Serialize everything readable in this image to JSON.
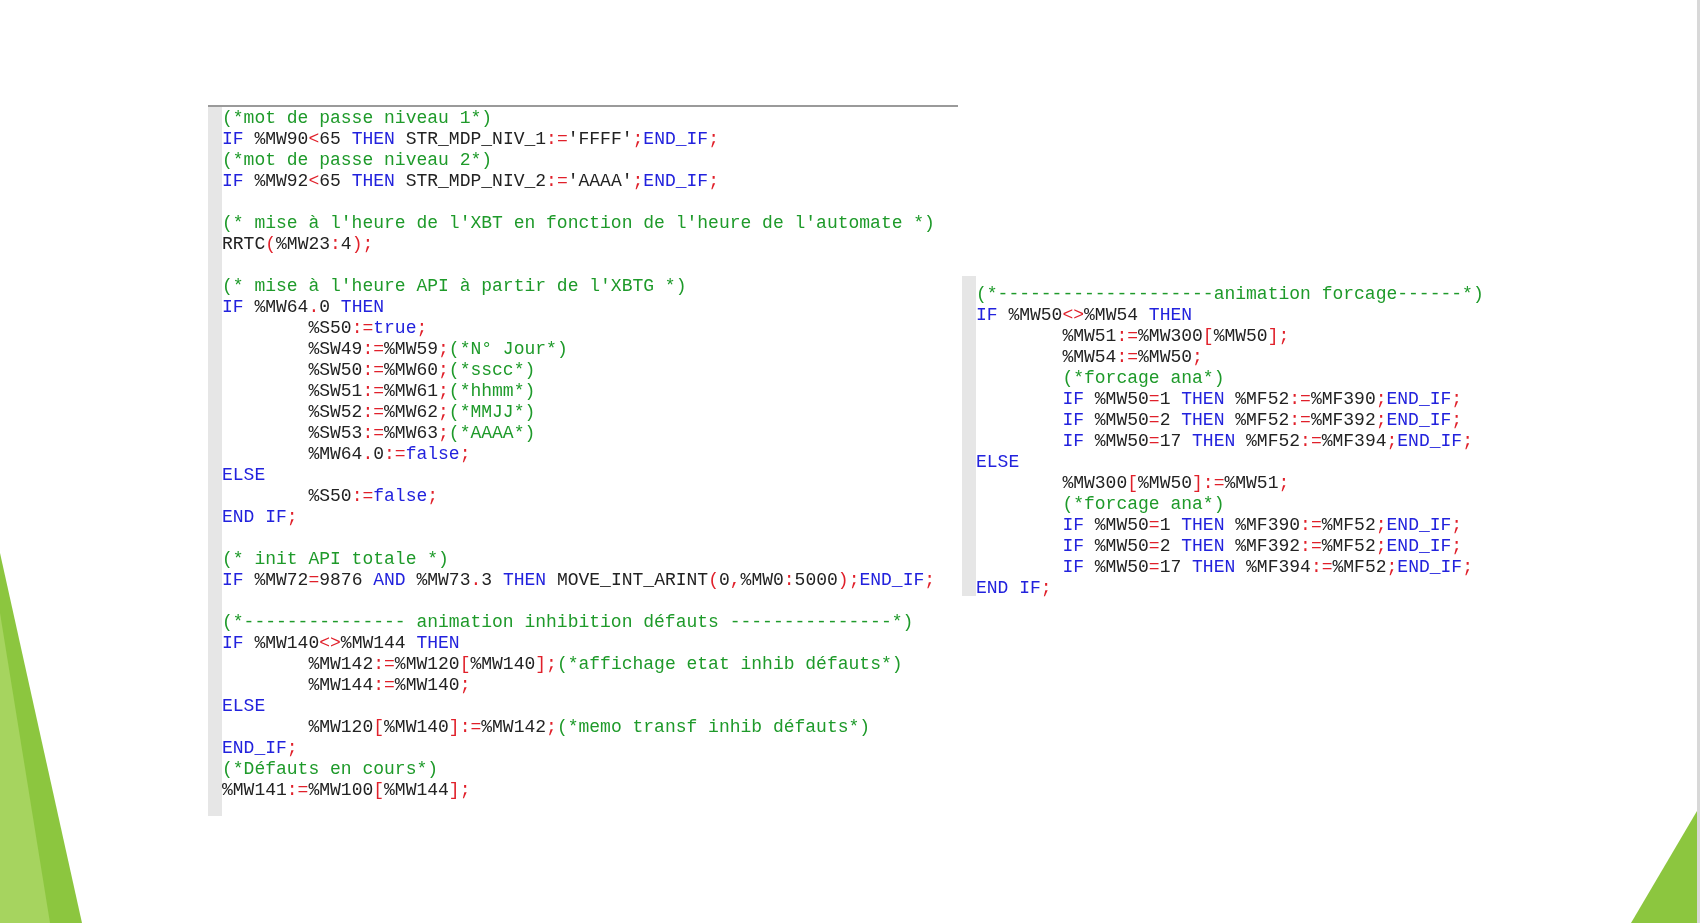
{
  "panels": [
    {
      "lines": [
        {
          "kind": "code",
          "indent": false,
          "tokens": [
            {
              "kind": "comment",
              "text": "(*mot de passe niveau 1*)"
            }
          ]
        },
        {
          "kind": "code",
          "indent": false,
          "tokens": [
            {
              "kind": "keyword",
              "text": "IF"
            },
            {
              "kind": "plain",
              "text": " %MW90"
            },
            {
              "kind": "operator",
              "text": "<"
            },
            {
              "kind": "plain",
              "text": "65 "
            },
            {
              "kind": "keyword",
              "text": "THEN"
            },
            {
              "kind": "plain",
              "text": " STR_MDP_NIV_1"
            },
            {
              "kind": "operator",
              "text": ":="
            },
            {
              "kind": "plain",
              "text": "'FFFF'"
            },
            {
              "kind": "operator",
              "text": ";"
            },
            {
              "kind": "keyword",
              "text": "END_IF"
            },
            {
              "kind": "operator",
              "text": ";"
            }
          ]
        },
        {
          "kind": "code",
          "indent": false,
          "tokens": [
            {
              "kind": "comment",
              "text": "(*mot de passe niveau 2*)"
            }
          ]
        },
        {
          "kind": "code",
          "indent": false,
          "tokens": [
            {
              "kind": "keyword",
              "text": "IF"
            },
            {
              "kind": "plain",
              "text": " %MW92"
            },
            {
              "kind": "operator",
              "text": "<"
            },
            {
              "kind": "plain",
              "text": "65 "
            },
            {
              "kind": "keyword",
              "text": "THEN"
            },
            {
              "kind": "plain",
              "text": " STR_MDP_NIV_2"
            },
            {
              "kind": "operator",
              "text": ":="
            },
            {
              "kind": "plain",
              "text": "'AAAA'"
            },
            {
              "kind": "operator",
              "text": ";"
            },
            {
              "kind": "keyword",
              "text": "END_IF"
            },
            {
              "kind": "operator",
              "text": ";"
            }
          ]
        },
        {
          "kind": "blank"
        },
        {
          "kind": "code",
          "indent": false,
          "tokens": [
            {
              "kind": "comment",
              "text": "(* mise à l'heure de l'XBT en fonction de l'heure de l'automate *)"
            }
          ]
        },
        {
          "kind": "code",
          "indent": false,
          "tokens": [
            {
              "kind": "plain",
              "text": "RRTC"
            },
            {
              "kind": "operator",
              "text": "("
            },
            {
              "kind": "plain",
              "text": "%MW23"
            },
            {
              "kind": "operator",
              "text": ":"
            },
            {
              "kind": "plain",
              "text": "4"
            },
            {
              "kind": "operator",
              "text": ");"
            }
          ]
        },
        {
          "kind": "blank"
        },
        {
          "kind": "code",
          "indent": false,
          "tokens": [
            {
              "kind": "comment",
              "text": "(* mise à l'heure API à partir de l'XBTG *)"
            }
          ]
        },
        {
          "kind": "code",
          "indent": false,
          "tokens": [
            {
              "kind": "keyword",
              "text": "IF"
            },
            {
              "kind": "plain",
              "text": " %MW64"
            },
            {
              "kind": "operator",
              "text": "."
            },
            {
              "kind": "plain",
              "text": "0 "
            },
            {
              "kind": "keyword",
              "text": "THEN"
            }
          ]
        },
        {
          "kind": "code",
          "indent": true,
          "tokens": [
            {
              "kind": "plain",
              "text": "%S50"
            },
            {
              "kind": "operator",
              "text": ":="
            },
            {
              "kind": "keyword",
              "text": "true"
            },
            {
              "kind": "operator",
              "text": ";"
            }
          ]
        },
        {
          "kind": "code",
          "indent": true,
          "tokens": [
            {
              "kind": "plain",
              "text": "%SW49"
            },
            {
              "kind": "operator",
              "text": ":="
            },
            {
              "kind": "plain",
              "text": "%MW59"
            },
            {
              "kind": "operator",
              "text": ";"
            },
            {
              "kind": "comment",
              "text": "(*N° Jour*)"
            }
          ]
        },
        {
          "kind": "code",
          "indent": true,
          "tokens": [
            {
              "kind": "plain",
              "text": "%SW50"
            },
            {
              "kind": "operator",
              "text": ":="
            },
            {
              "kind": "plain",
              "text": "%MW60"
            },
            {
              "kind": "operator",
              "text": ";"
            },
            {
              "kind": "comment",
              "text": "(*sscc*)"
            }
          ]
        },
        {
          "kind": "code",
          "indent": true,
          "tokens": [
            {
              "kind": "plain",
              "text": "%SW51"
            },
            {
              "kind": "operator",
              "text": ":="
            },
            {
              "kind": "plain",
              "text": "%MW61"
            },
            {
              "kind": "operator",
              "text": ";"
            },
            {
              "kind": "comment",
              "text": "(*hhmm*)"
            }
          ]
        },
        {
          "kind": "code",
          "indent": true,
          "tokens": [
            {
              "kind": "plain",
              "text": "%SW52"
            },
            {
              "kind": "operator",
              "text": ":="
            },
            {
              "kind": "plain",
              "text": "%MW62"
            },
            {
              "kind": "operator",
              "text": ";"
            },
            {
              "kind": "comment",
              "text": "(*MMJJ*)"
            }
          ]
        },
        {
          "kind": "code",
          "indent": true,
          "tokens": [
            {
              "kind": "plain",
              "text": "%SW53"
            },
            {
              "kind": "operator",
              "text": ":="
            },
            {
              "kind": "plain",
              "text": "%MW63"
            },
            {
              "kind": "operator",
              "text": ";"
            },
            {
              "kind": "comment",
              "text": "(*AAAA*)"
            }
          ]
        },
        {
          "kind": "code",
          "indent": true,
          "tokens": [
            {
              "kind": "plain",
              "text": "%MW64"
            },
            {
              "kind": "operator",
              "text": "."
            },
            {
              "kind": "plain",
              "text": "0"
            },
            {
              "kind": "operator",
              "text": ":="
            },
            {
              "kind": "keyword",
              "text": "false"
            },
            {
              "kind": "operator",
              "text": ";"
            }
          ]
        },
        {
          "kind": "code",
          "indent": false,
          "tokens": [
            {
              "kind": "keyword",
              "text": "ELSE"
            }
          ]
        },
        {
          "kind": "code",
          "indent": true,
          "tokens": [
            {
              "kind": "plain",
              "text": "%S50"
            },
            {
              "kind": "operator",
              "text": ":="
            },
            {
              "kind": "keyword",
              "text": "false"
            },
            {
              "kind": "operator",
              "text": ";"
            }
          ]
        },
        {
          "kind": "code",
          "indent": false,
          "tokens": [
            {
              "kind": "keyword",
              "text": "END IF"
            },
            {
              "kind": "operator",
              "text": ";"
            }
          ]
        },
        {
          "kind": "blank"
        },
        {
          "kind": "code",
          "indent": false,
          "tokens": [
            {
              "kind": "comment",
              "text": "(* init API totale *)"
            }
          ]
        },
        {
          "kind": "code",
          "indent": false,
          "tokens": [
            {
              "kind": "keyword",
              "text": "IF"
            },
            {
              "kind": "plain",
              "text": " %MW72"
            },
            {
              "kind": "operator",
              "text": "="
            },
            {
              "kind": "plain",
              "text": "9876 "
            },
            {
              "kind": "keyword",
              "text": "AND"
            },
            {
              "kind": "plain",
              "text": " %MW73"
            },
            {
              "kind": "operator",
              "text": "."
            },
            {
              "kind": "plain",
              "text": "3 "
            },
            {
              "kind": "keyword",
              "text": "THEN"
            },
            {
              "kind": "plain",
              "text": " MOVE_INT_ARINT"
            },
            {
              "kind": "operator",
              "text": "("
            },
            {
              "kind": "plain",
              "text": "0"
            },
            {
              "kind": "operator",
              "text": ","
            },
            {
              "kind": "plain",
              "text": "%MW0"
            },
            {
              "kind": "operator",
              "text": ":"
            },
            {
              "kind": "plain",
              "text": "5000"
            },
            {
              "kind": "operator",
              "text": ");"
            },
            {
              "kind": "keyword",
              "text": "END_IF"
            },
            {
              "kind": "operator",
              "text": ";"
            }
          ]
        },
        {
          "kind": "blank"
        },
        {
          "kind": "code",
          "indent": false,
          "tokens": [
            {
              "kind": "comment",
              "text": "(*--------------- animation inhibition défauts ---------------*)"
            }
          ]
        },
        {
          "kind": "code",
          "indent": false,
          "tokens": [
            {
              "kind": "keyword",
              "text": "IF"
            },
            {
              "kind": "plain",
              "text": " %MW140"
            },
            {
              "kind": "operator",
              "text": "<>"
            },
            {
              "kind": "plain",
              "text": "%MW144 "
            },
            {
              "kind": "keyword",
              "text": "THEN"
            }
          ]
        },
        {
          "kind": "code",
          "indent": true,
          "tokens": [
            {
              "kind": "plain",
              "text": "%MW142"
            },
            {
              "kind": "operator",
              "text": ":="
            },
            {
              "kind": "plain",
              "text": "%MW120"
            },
            {
              "kind": "operator",
              "text": "["
            },
            {
              "kind": "plain",
              "text": "%MW140"
            },
            {
              "kind": "operator",
              "text": "];"
            },
            {
              "kind": "comment",
              "text": "(*affichage etat inhib défauts*)"
            }
          ]
        },
        {
          "kind": "code",
          "indent": true,
          "tokens": [
            {
              "kind": "plain",
              "text": "%MW144"
            },
            {
              "kind": "operator",
              "text": ":="
            },
            {
              "kind": "plain",
              "text": "%MW140"
            },
            {
              "kind": "operator",
              "text": ";"
            }
          ]
        },
        {
          "kind": "code",
          "indent": false,
          "tokens": [
            {
              "kind": "keyword",
              "text": "ELSE"
            }
          ]
        },
        {
          "kind": "code",
          "indent": true,
          "tokens": [
            {
              "kind": "plain",
              "text": "%MW120"
            },
            {
              "kind": "operator",
              "text": "["
            },
            {
              "kind": "plain",
              "text": "%MW140"
            },
            {
              "kind": "operator",
              "text": "]:="
            },
            {
              "kind": "plain",
              "text": "%MW142"
            },
            {
              "kind": "operator",
              "text": ";"
            },
            {
              "kind": "comment",
              "text": "(*memo transf inhib défauts*)"
            }
          ]
        },
        {
          "kind": "code",
          "indent": false,
          "tokens": [
            {
              "kind": "keyword",
              "text": "END_IF"
            },
            {
              "kind": "operator",
              "text": ";"
            }
          ]
        },
        {
          "kind": "code",
          "indent": false,
          "tokens": [
            {
              "kind": "comment",
              "text": "(*Défauts en cours*)"
            }
          ]
        },
        {
          "kind": "code",
          "indent": false,
          "tokens": [
            {
              "kind": "plain",
              "text": "%MW141"
            },
            {
              "kind": "operator",
              "text": ":="
            },
            {
              "kind": "plain",
              "text": "%MW100"
            },
            {
              "kind": "operator",
              "text": "["
            },
            {
              "kind": "plain",
              "text": "%MW144"
            },
            {
              "kind": "operator",
              "text": "];"
            }
          ]
        }
      ]
    },
    {
      "lines": [
        {
          "kind": "code",
          "indent": false,
          "tokens": [
            {
              "kind": "comment",
              "text": "(*--------------------animation forcage------*)"
            }
          ]
        },
        {
          "kind": "code",
          "indent": false,
          "tokens": [
            {
              "kind": "keyword",
              "text": "IF"
            },
            {
              "kind": "plain",
              "text": " %MW50"
            },
            {
              "kind": "operator",
              "text": "<>"
            },
            {
              "kind": "plain",
              "text": "%MW54 "
            },
            {
              "kind": "keyword",
              "text": "THEN"
            }
          ]
        },
        {
          "kind": "code",
          "indent": true,
          "tokens": [
            {
              "kind": "plain",
              "text": "%MW51"
            },
            {
              "kind": "operator",
              "text": ":="
            },
            {
              "kind": "plain",
              "text": "%MW300"
            },
            {
              "kind": "operator",
              "text": "["
            },
            {
              "kind": "plain",
              "text": "%MW50"
            },
            {
              "kind": "operator",
              "text": "];"
            }
          ]
        },
        {
          "kind": "code",
          "indent": true,
          "tokens": [
            {
              "kind": "plain",
              "text": "%MW54"
            },
            {
              "kind": "operator",
              "text": ":="
            },
            {
              "kind": "plain",
              "text": "%MW50"
            },
            {
              "kind": "operator",
              "text": ";"
            }
          ]
        },
        {
          "kind": "code",
          "indent": true,
          "tokens": [
            {
              "kind": "comment",
              "text": "(*forcage ana*)"
            }
          ]
        },
        {
          "kind": "code",
          "indent": true,
          "tokens": [
            {
              "kind": "keyword",
              "text": "IF"
            },
            {
              "kind": "plain",
              "text": " %MW50"
            },
            {
              "kind": "operator",
              "text": "="
            },
            {
              "kind": "plain",
              "text": "1 "
            },
            {
              "kind": "keyword",
              "text": "THEN"
            },
            {
              "kind": "plain",
              "text": " %MF52"
            },
            {
              "kind": "operator",
              "text": ":="
            },
            {
              "kind": "plain",
              "text": "%MF390"
            },
            {
              "kind": "operator",
              "text": ";"
            },
            {
              "kind": "keyword",
              "text": "END_IF"
            },
            {
              "kind": "operator",
              "text": ";"
            }
          ]
        },
        {
          "kind": "code",
          "indent": true,
          "tokens": [
            {
              "kind": "keyword",
              "text": "IF"
            },
            {
              "kind": "plain",
              "text": " %MW50"
            },
            {
              "kind": "operator",
              "text": "="
            },
            {
              "kind": "plain",
              "text": "2 "
            },
            {
              "kind": "keyword",
              "text": "THEN"
            },
            {
              "kind": "plain",
              "text": " %MF52"
            },
            {
              "kind": "operator",
              "text": ":="
            },
            {
              "kind": "plain",
              "text": "%MF392"
            },
            {
              "kind": "operator",
              "text": ";"
            },
            {
              "kind": "keyword",
              "text": "END_IF"
            },
            {
              "kind": "operator",
              "text": ";"
            }
          ]
        },
        {
          "kind": "code",
          "indent": true,
          "tokens": [
            {
              "kind": "keyword",
              "text": "IF"
            },
            {
              "kind": "plain",
              "text": " %MW50"
            },
            {
              "kind": "operator",
              "text": "="
            },
            {
              "kind": "plain",
              "text": "17 "
            },
            {
              "kind": "keyword",
              "text": "THEN"
            },
            {
              "kind": "plain",
              "text": " %MF52"
            },
            {
              "kind": "operator",
              "text": ":="
            },
            {
              "kind": "plain",
              "text": "%MF394"
            },
            {
              "kind": "operator",
              "text": ";"
            },
            {
              "kind": "keyword",
              "text": "END_IF"
            },
            {
              "kind": "operator",
              "text": ";"
            }
          ]
        },
        {
          "kind": "code",
          "indent": false,
          "tokens": [
            {
              "kind": "keyword",
              "text": "ELSE"
            }
          ]
        },
        {
          "kind": "code",
          "indent": true,
          "tokens": [
            {
              "kind": "plain",
              "text": "%MW300"
            },
            {
              "kind": "operator",
              "text": "["
            },
            {
              "kind": "plain",
              "text": "%MW50"
            },
            {
              "kind": "operator",
              "text": "]:="
            },
            {
              "kind": "plain",
              "text": "%MW51"
            },
            {
              "kind": "operator",
              "text": ";"
            }
          ]
        },
        {
          "kind": "code",
          "indent": true,
          "tokens": [
            {
              "kind": "comment",
              "text": "(*forcage ana*)"
            }
          ]
        },
        {
          "kind": "code",
          "indent": true,
          "tokens": [
            {
              "kind": "keyword",
              "text": "IF"
            },
            {
              "kind": "plain",
              "text": " %MW50"
            },
            {
              "kind": "operator",
              "text": "="
            },
            {
              "kind": "plain",
              "text": "1 "
            },
            {
              "kind": "keyword",
              "text": "THEN"
            },
            {
              "kind": "plain",
              "text": " %MF390"
            },
            {
              "kind": "operator",
              "text": ":="
            },
            {
              "kind": "plain",
              "text": "%MF52"
            },
            {
              "kind": "operator",
              "text": ";"
            },
            {
              "kind": "keyword",
              "text": "END_IF"
            },
            {
              "kind": "operator",
              "text": ";"
            }
          ]
        },
        {
          "kind": "code",
          "indent": true,
          "tokens": [
            {
              "kind": "keyword",
              "text": "IF"
            },
            {
              "kind": "plain",
              "text": " %MW50"
            },
            {
              "kind": "operator",
              "text": "="
            },
            {
              "kind": "plain",
              "text": "2 "
            },
            {
              "kind": "keyword",
              "text": "THEN"
            },
            {
              "kind": "plain",
              "text": " %MF392"
            },
            {
              "kind": "operator",
              "text": ":="
            },
            {
              "kind": "plain",
              "text": "%MF52"
            },
            {
              "kind": "operator",
              "text": ";"
            },
            {
              "kind": "keyword",
              "text": "END_IF"
            },
            {
              "kind": "operator",
              "text": ";"
            }
          ]
        },
        {
          "kind": "code",
          "indent": true,
          "tokens": [
            {
              "kind": "keyword",
              "text": "IF"
            },
            {
              "kind": "plain",
              "text": " %MW50"
            },
            {
              "kind": "operator",
              "text": "="
            },
            {
              "kind": "plain",
              "text": "17 "
            },
            {
              "kind": "keyword",
              "text": "THEN"
            },
            {
              "kind": "plain",
              "text": " %MF394"
            },
            {
              "kind": "operator",
              "text": ":="
            },
            {
              "kind": "plain",
              "text": "%MF52"
            },
            {
              "kind": "operator",
              "text": ";"
            },
            {
              "kind": "keyword",
              "text": "END_IF"
            },
            {
              "kind": "operator",
              "text": ";"
            }
          ]
        },
        {
          "kind": "code",
          "indent": false,
          "tokens": [
            {
              "kind": "keyword",
              "text": "END IF"
            },
            {
              "kind": "operator",
              "text": ";"
            }
          ]
        }
      ]
    }
  ]
}
